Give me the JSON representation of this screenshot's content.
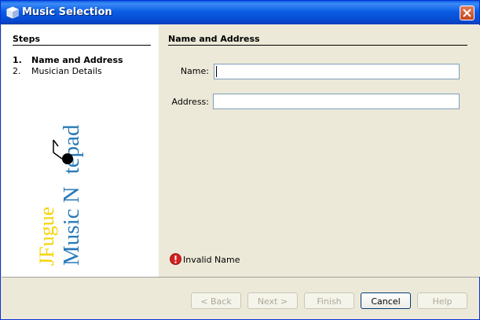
{
  "window": {
    "title": "Music Selection"
  },
  "steps": {
    "header": "Steps",
    "items": [
      {
        "num": "1.",
        "label": "Name and Address"
      },
      {
        "num": "2.",
        "label": "Musician Details"
      }
    ]
  },
  "logo": {
    "line1": "JFugue",
    "line2a": "Music N",
    "line2b": "tepad"
  },
  "panel": {
    "title": "Name and Address",
    "name_label": "Name:",
    "name_value": "",
    "address_label": "Address:",
    "address_value": ""
  },
  "status": {
    "error": "Invalid Name"
  },
  "buttons": {
    "back": "< Back",
    "next": "Next >",
    "finish": "Finish",
    "cancel": "Cancel",
    "help": "Help"
  },
  "colors": {
    "logo_yellow": "#f5d300",
    "logo_blue": "#2a7ab8",
    "error_red": "#d42020"
  }
}
